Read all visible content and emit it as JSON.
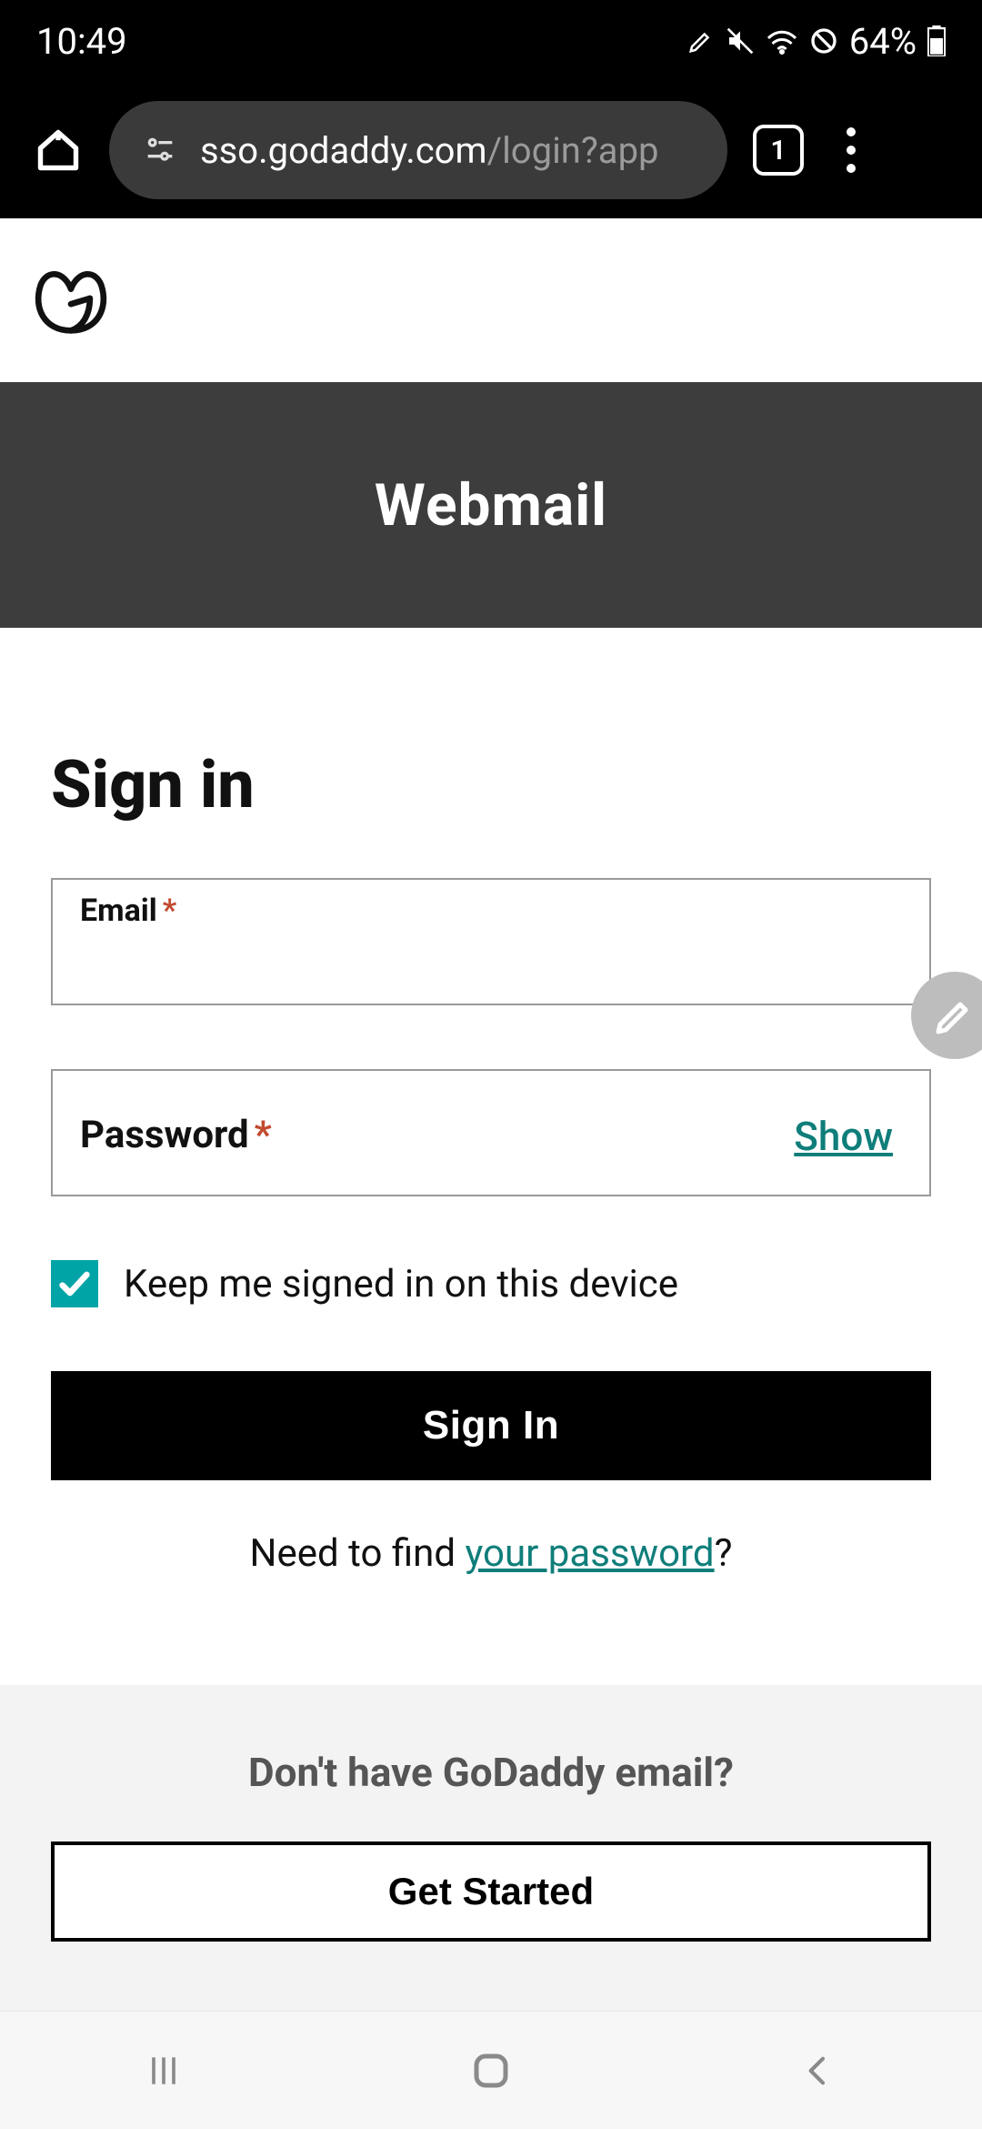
{
  "statusbar": {
    "time": "10:49",
    "battery_text": "64%"
  },
  "browser": {
    "url_visible_primary": "sso.godaddy.com",
    "url_visible_secondary": "/login?app",
    "tab_count": "1"
  },
  "page": {
    "banner_title": "Webmail",
    "signin_heading": "Sign in",
    "email_label": "Email",
    "password_label": "Password",
    "required_mark": "*",
    "show_password": "Show",
    "keep_signed_in": "Keep me signed in on this device",
    "keep_signed_in_checked": true,
    "submit_label": "Sign In",
    "forgot_prefix": "Need to find ",
    "forgot_link": "your password",
    "forgot_suffix": "?",
    "cta_heading": "Don't have GoDaddy email?",
    "cta_button": "Get Started"
  }
}
